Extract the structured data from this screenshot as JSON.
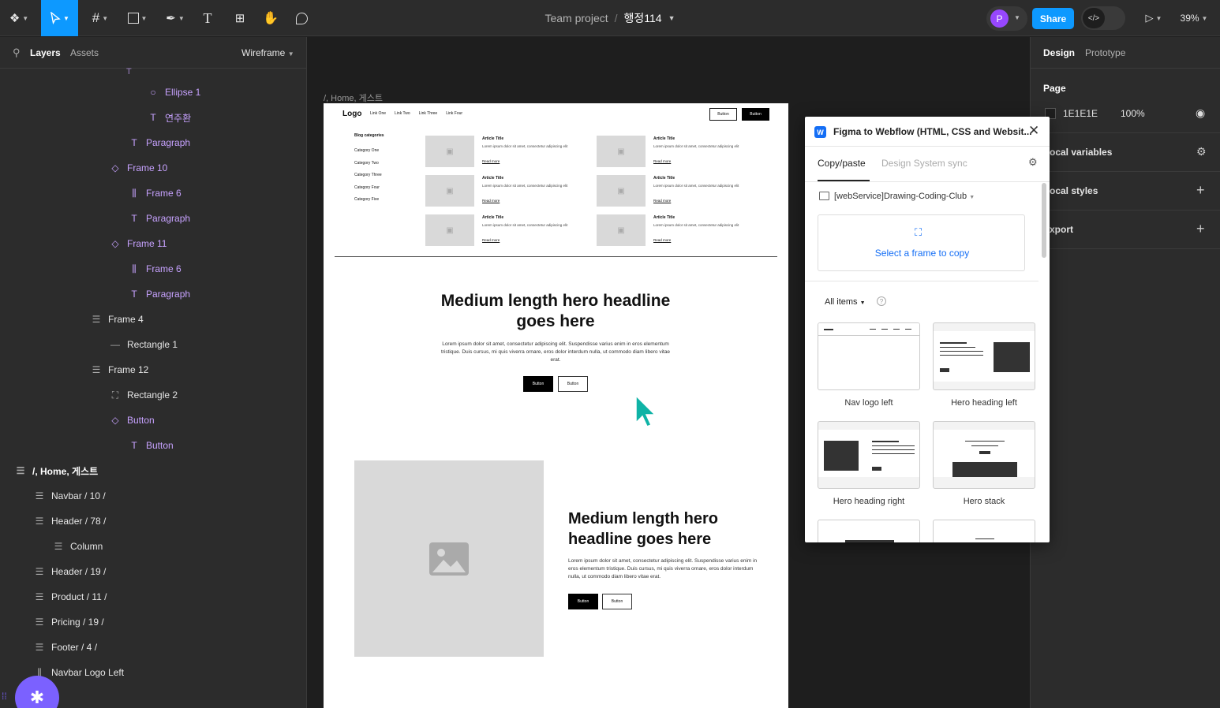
{
  "toolbar": {
    "menu_icon": "figma-logo-icon",
    "tools": [
      "move-tool",
      "frame-tool",
      "shape-tool",
      "pen-tool",
      "text-tool",
      "resources-tool",
      "hand-tool",
      "comment-tool"
    ],
    "text_tool_glyph": "T",
    "project": "Team project",
    "separator": "/",
    "file_name": "행정114",
    "avatar_initial": "P",
    "share_label": "Share",
    "zoom": "39%",
    "accent": "#0d99ff"
  },
  "left_panel": {
    "tab_layers": "Layers",
    "tab_assets": "Assets",
    "page_select": "Wireframe",
    "layers": [
      {
        "label": "Ellipse 1",
        "icon": "ellipse-icon",
        "glyph": "○",
        "style": "purple",
        "indent": 3
      },
      {
        "label": "연주환",
        "icon": "text-icon",
        "glyph": "T",
        "style": "purple",
        "indent": 3
      },
      {
        "label": "Paragraph",
        "icon": "text-icon",
        "glyph": "T",
        "style": "purple",
        "indent": 2
      },
      {
        "label": "Frame 10",
        "icon": "component-instance-icon",
        "glyph": "◇",
        "style": "purple",
        "indent": 1
      },
      {
        "label": "Frame 6",
        "icon": "auto-layout-icon",
        "glyph": "⫼",
        "style": "purple",
        "indent": 2
      },
      {
        "label": "Paragraph",
        "icon": "text-icon",
        "glyph": "T",
        "style": "purple",
        "indent": 2
      },
      {
        "label": "Frame 11",
        "icon": "component-instance-icon",
        "glyph": "◇",
        "style": "purple",
        "indent": 1
      },
      {
        "label": "Frame 6",
        "icon": "auto-layout-icon",
        "glyph": "⫼",
        "style": "purple",
        "indent": 2
      },
      {
        "label": "Paragraph",
        "icon": "text-icon",
        "glyph": "T",
        "style": "purple",
        "indent": 2
      },
      {
        "label": "Frame 4",
        "icon": "auto-layout-icon",
        "glyph": "☰",
        "style": "normal",
        "indent": 0
      },
      {
        "label": "Rectangle 1",
        "icon": "line-icon",
        "glyph": "—",
        "style": "normal",
        "indent": 1
      },
      {
        "label": "Frame 12",
        "icon": "auto-layout-icon",
        "glyph": "☰",
        "style": "normal",
        "indent": 0
      },
      {
        "label": "Rectangle 2",
        "icon": "rectangle-icon",
        "glyph": "⛶",
        "style": "normal",
        "indent": 1
      },
      {
        "label": "Button",
        "icon": "component-instance-icon",
        "glyph": "◇",
        "style": "purple",
        "indent": 1
      },
      {
        "label": "Button",
        "icon": "text-icon",
        "glyph": "T",
        "style": "purple",
        "indent": 2
      },
      {
        "label": "/, Home, 게스트",
        "icon": "auto-layout-icon",
        "glyph": "☰",
        "style": "bold",
        "indent": -3
      },
      {
        "label": "Navbar / 10 /",
        "icon": "auto-layout-icon",
        "glyph": "☰",
        "style": "normal",
        "indent": -2
      },
      {
        "label": "Header / 78 /",
        "icon": "auto-layout-icon",
        "glyph": "☰",
        "style": "normal",
        "indent": -2
      },
      {
        "label": "Column",
        "icon": "auto-layout-icon",
        "glyph": "☰",
        "style": "normal",
        "indent": -1
      },
      {
        "label": "Header / 19 /",
        "icon": "auto-layout-icon",
        "glyph": "☰",
        "style": "normal",
        "indent": -2
      },
      {
        "label": "Product / 11 /",
        "icon": "auto-layout-icon",
        "glyph": "☰",
        "style": "normal",
        "indent": -2
      },
      {
        "label": "Pricing / 19 /",
        "icon": "auto-layout-icon",
        "glyph": "☰",
        "style": "normal",
        "indent": -2
      },
      {
        "label": "Footer / 4 /",
        "icon": "auto-layout-icon",
        "glyph": "☰",
        "style": "normal",
        "indent": -2
      },
      {
        "label": "Navbar Logo Left",
        "icon": "auto-layout-icon",
        "glyph": "⫼",
        "style": "normal",
        "indent": -2
      }
    ]
  },
  "canvas": {
    "frame_label": "/, Home, 게스트",
    "nav": {
      "logo": "Logo",
      "links": [
        "Link One",
        "Link Two",
        "Link Three",
        "Link Four"
      ],
      "button1": "Button",
      "button2": "Button"
    },
    "blog": {
      "categories_title": "Blog categories",
      "categories": [
        "Category One",
        "Category Two",
        "Category Three",
        "Category Four",
        "Category Five"
      ],
      "article_title": "Article Title",
      "article_text": "Lorem ipsum dolor sit amet, consectetur adipiscing elit",
      "read_more": "Read more"
    },
    "hero": {
      "headline": "Medium length hero headline goes here",
      "text": "Lorem ipsum dolor sit amet, consectetur adipiscing elit. Suspendisse varius enim in eros elementum tristique. Duis cursus, mi quis viverra ornare, eros dolor interdum nulla, ut commodo diam libero vitae erat.",
      "button1": "Button",
      "button2": "Button"
    },
    "hero2": {
      "headline": "Medium length hero headline goes here",
      "text": "Lorem ipsum dolor sit amet, consectetur adipiscing elit. Suspendisse varius enim in eros elementum tristique. Duis cursus, mi quis viverra ornare, eros dolor interdum nulla, ut commodo diam libero vitae erat.",
      "button1": "Button",
      "button2": "Button"
    }
  },
  "plugin": {
    "title": "Figma to Webflow (HTML, CSS and Websit...",
    "tab_copy": "Copy/paste",
    "tab_design": "Design System sync",
    "site": "[webService]Drawing-Coding-Club",
    "select_frame": "Select a frame to copy",
    "filter": "All items",
    "tiles": [
      "Nav logo left",
      "Hero heading left",
      "Hero heading right",
      "Hero stack"
    ]
  },
  "right_panel": {
    "tab_design": "Design",
    "tab_prototype": "Prototype",
    "page_heading": "Page",
    "page_color": "1E1E1E",
    "page_opacity": "100%",
    "local_variables": "ocal variables",
    "local_styles": "ocal styles",
    "export": "xport"
  }
}
